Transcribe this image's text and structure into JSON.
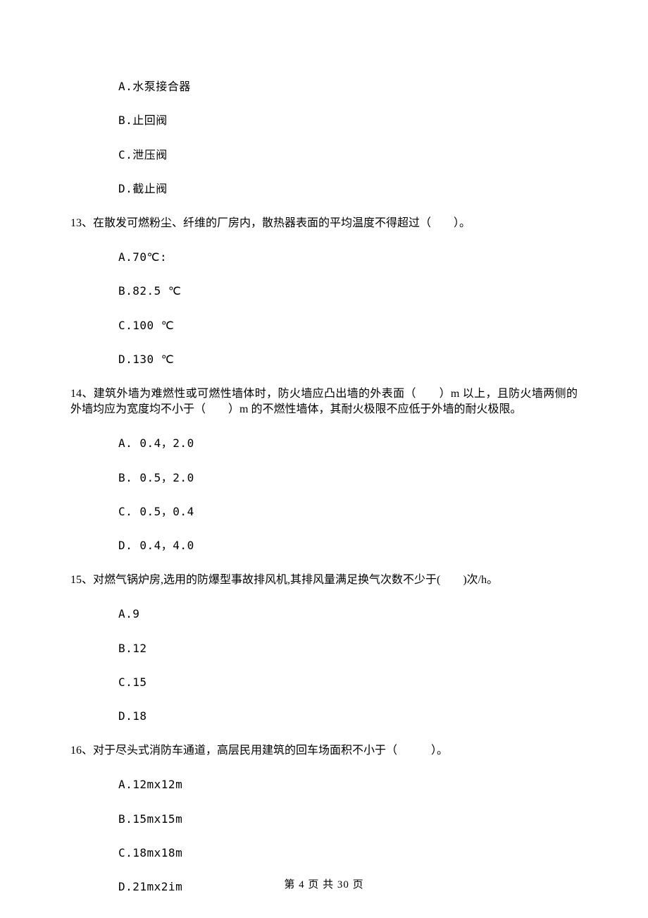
{
  "q12": {
    "options": {
      "A": "A.水泵接合器",
      "B": "B.止回阀",
      "C": "C.泄压阀",
      "D": "D.截止阀"
    }
  },
  "q13": {
    "text": "13、在散发可燃粉尘、纤维的厂房内，散热器表面的平均温度不得超过（　　）。",
    "options": {
      "A": "A.70℃:",
      "B": "B.82.5 ℃",
      "C": "C.100 ℃",
      "D": "D.130 ℃"
    }
  },
  "q14": {
    "text": "14、建筑外墙为难燃性或可燃性墙体时，防火墙应凸出墙的外表面（　　）m 以上，且防火墙两侧的外墙均应为宽度均不小于（　　）m 的不燃性墙体，其耐火极限不应低于外墙的耐火极限。",
    "options": {
      "A": "A. 0.4，2.0",
      "B": "B. 0.5，2.0",
      "C": "C. 0.5，0.4",
      "D": "D. 0.4，4.0"
    }
  },
  "q15": {
    "text": "15、对燃气锅炉房,选用的防爆型事故排风机,其排风量满足换气次数不少于(　　)次/h。",
    "options": {
      "A": "A.9",
      "B": "B.12",
      "C": "C.15",
      "D": "D.18"
    }
  },
  "q16": {
    "text": "16、对于尽头式消防车通道，高层民用建筑的回车场面积不小于（　　　）。",
    "options": {
      "A": "A.12mx12m",
      "B": "B.15mx15m",
      "C": "C.18mx18m",
      "D": "D.21mx2im"
    }
  },
  "footer": "第 4 页 共 30 页"
}
